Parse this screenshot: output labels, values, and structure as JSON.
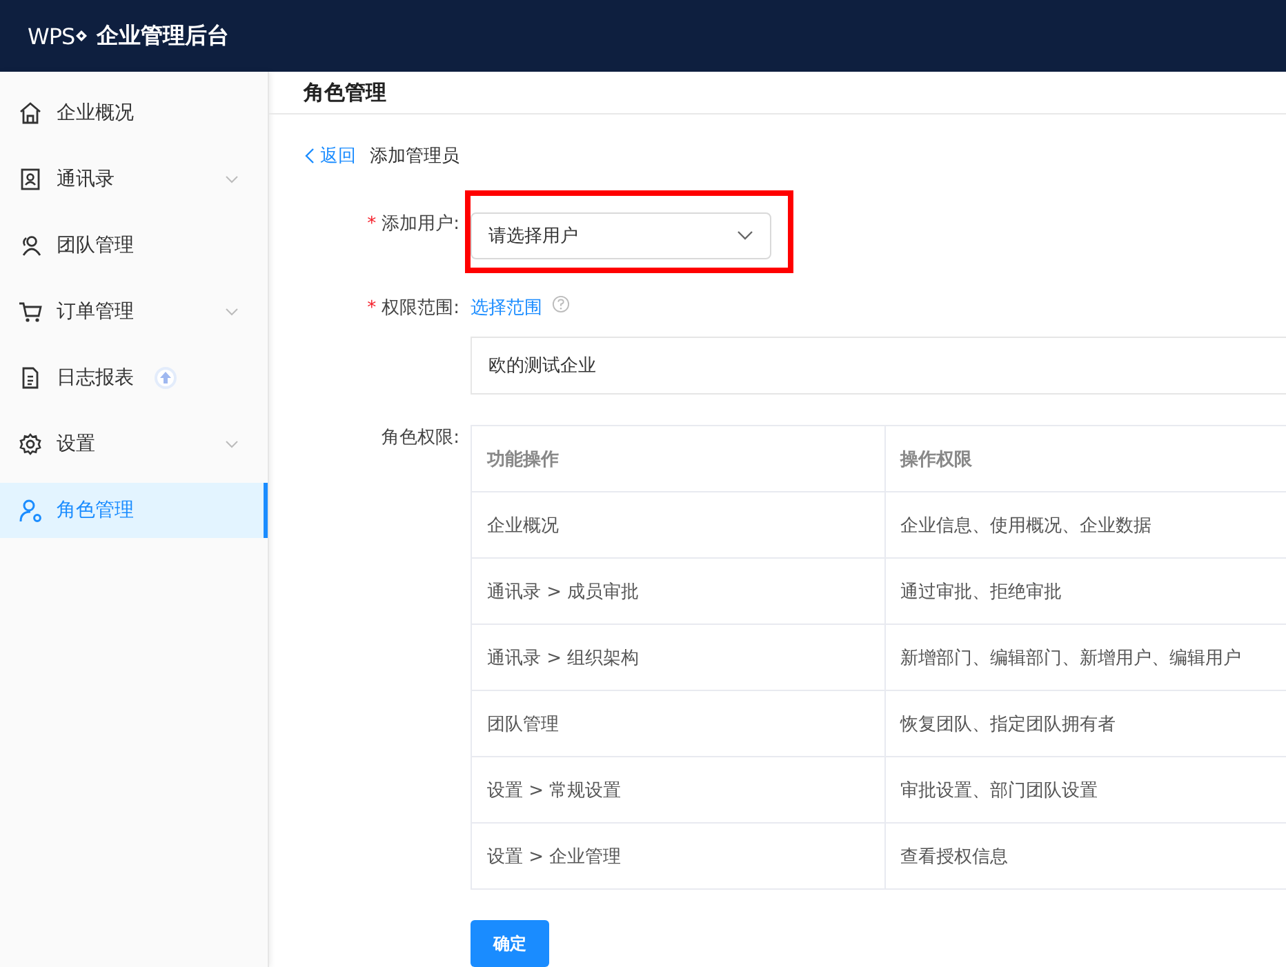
{
  "header": {
    "logo": "WPS",
    "title": "企业管理后台"
  },
  "sidebar": {
    "items": [
      {
        "label": "企业概况",
        "selected": false,
        "has_submenu": false,
        "badge": false
      },
      {
        "label": "通讯录",
        "selected": false,
        "has_submenu": true,
        "badge": false
      },
      {
        "label": "团队管理",
        "selected": false,
        "has_submenu": false,
        "badge": false
      },
      {
        "label": "订单管理",
        "selected": false,
        "has_submenu": true,
        "badge": false
      },
      {
        "label": "日志报表",
        "selected": false,
        "has_submenu": false,
        "badge": true
      },
      {
        "label": "设置",
        "selected": false,
        "has_submenu": true,
        "badge": false
      },
      {
        "label": "角色管理",
        "selected": true,
        "has_submenu": false,
        "badge": false
      }
    ]
  },
  "page_title": "角色管理",
  "breadcrumb": {
    "back": "返回",
    "current": "添加管理员"
  },
  "form": {
    "user": {
      "required_mark": "*",
      "label": "添加用户:",
      "placeholder": "请选择用户",
      "highlighted": true
    },
    "scope": {
      "required_mark": "*",
      "label": "权限范围:",
      "link": "选择范围",
      "value": "欧的测试企业"
    },
    "permissions": {
      "label": "角色权限:",
      "columns": [
        "功能操作",
        "操作权限"
      ],
      "rows": [
        [
          "企业概况",
          "企业信息、使用概况、企业数据"
        ],
        [
          "通讯录 > 成员审批",
          "通过审批、拒绝审批"
        ],
        [
          "通讯录 > 组织架构",
          "新增部门、编辑部门、新增用户、编辑用户"
        ],
        [
          "团队管理",
          "恢复团队、指定团队拥有者"
        ],
        [
          "设置 > 常规设置",
          "审批设置、部门团队设置"
        ],
        [
          "设置 > 企业管理",
          "查看授权信息"
        ]
      ]
    }
  },
  "confirm_button": "确定"
}
